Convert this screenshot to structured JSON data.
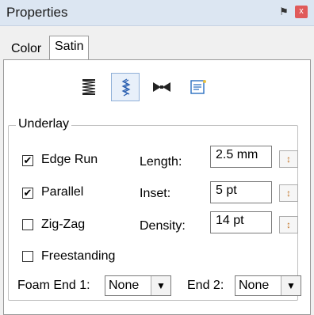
{
  "window": {
    "title": "Properties",
    "pin_glyph": "⚑",
    "close_glyph": "x"
  },
  "tabs": [
    {
      "label": "Color"
    },
    {
      "label": "Satin"
    }
  ],
  "toolbar": {
    "buttons": [
      {
        "icon": "satin-zigzag-icon",
        "selected": false
      },
      {
        "icon": "satin-stitch-icon",
        "selected": true
      },
      {
        "icon": "bowtie-icon",
        "selected": false
      },
      {
        "icon": "document-icon",
        "selected": false
      }
    ]
  },
  "underlay": {
    "legend": "Underlay",
    "options": [
      {
        "label": "Edge Run",
        "checked": true,
        "check_mark": "✔"
      },
      {
        "label": "Parallel",
        "checked": true,
        "check_mark": "✔"
      },
      {
        "label": "Zig-Zag",
        "checked": false,
        "check_mark": ""
      },
      {
        "label": "Freestanding",
        "checked": false,
        "check_mark": ""
      }
    ],
    "fields": [
      {
        "label": "Length:",
        "value": "2.5 mm",
        "spin_glyph": "↕"
      },
      {
        "label": "Inset:",
        "value": "5 pt",
        "spin_glyph": "↕"
      },
      {
        "label": "Density:",
        "value": "14 pt",
        "spin_glyph": "↕"
      }
    ],
    "foam_end_1": {
      "label": "Foam End 1:",
      "value": "None"
    },
    "end_2": {
      "label": "End 2:",
      "value": "None"
    }
  },
  "colors": {
    "titlebar": "#dce6f2",
    "close": "#e05a5a",
    "selected_border": "#90b0d8"
  }
}
